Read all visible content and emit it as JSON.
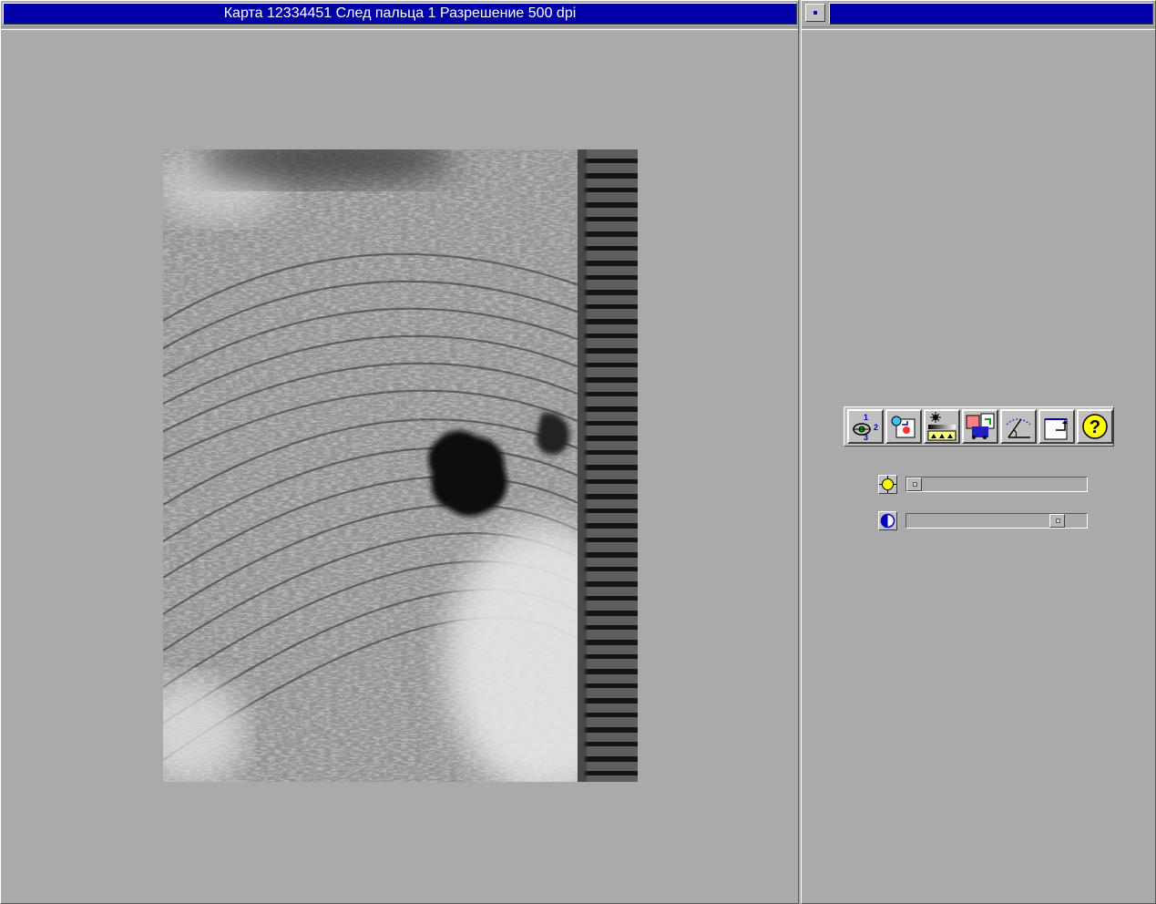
{
  "left_panel": {
    "title": "Карта 12334451 След пальца 1 Разрешение 500 dpi"
  },
  "right_panel": {
    "title": "",
    "system_button": "window-menu-icon",
    "toolbar": [
      {
        "name": "rotate-123-icon"
      },
      {
        "name": "image-transform-icon"
      },
      {
        "name": "brightness-levels-icon"
      },
      {
        "name": "color-convert-icon"
      },
      {
        "name": "angle-measure-icon"
      },
      {
        "name": "crop-export-icon"
      },
      {
        "name": "help-icon"
      }
    ],
    "brightness": {
      "icon": "sun-icon",
      "value": 0.0
    },
    "contrast": {
      "icon": "contrast-icon",
      "value": 0.87
    }
  },
  "colors": {
    "titlebar": "#0000a8",
    "pane_background": "#aaaaaa",
    "button_face": "#c0c0c0"
  }
}
